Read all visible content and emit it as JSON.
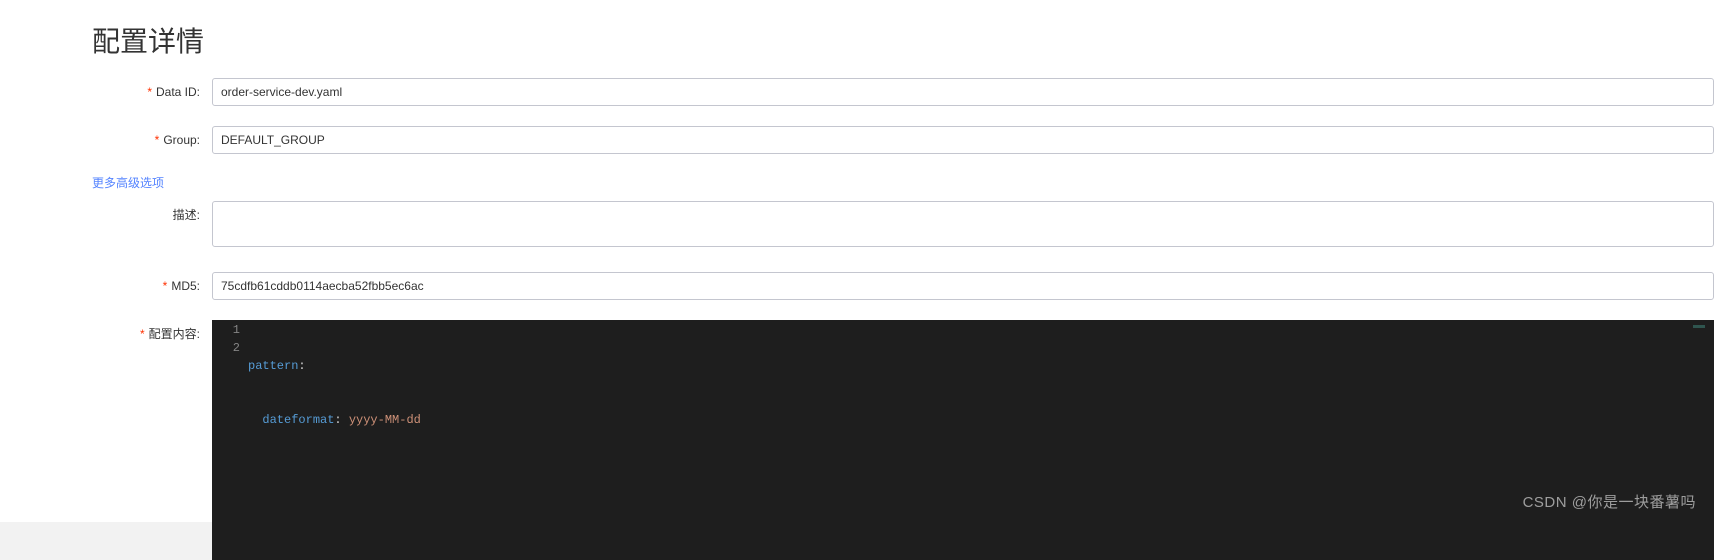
{
  "page": {
    "title": "配置详情"
  },
  "form": {
    "dataId": {
      "label": "Data ID:",
      "value": "order-service-dev.yaml"
    },
    "group": {
      "label": "Group:",
      "value": "DEFAULT_GROUP"
    },
    "advancedLink": "更多高级选项",
    "description": {
      "label": "描述:",
      "value": ""
    },
    "md5": {
      "label": "MD5:",
      "value": "75cdfb61cddb0114aecba52fbb5ec6ac"
    },
    "content": {
      "label": "配置内容:",
      "lines": [
        {
          "num": "1",
          "key": "pattern",
          "value": ""
        },
        {
          "num": "2",
          "indent": "  ",
          "key": "dateformat",
          "value": "yyyy-MM-dd"
        }
      ]
    }
  },
  "watermark": "CSDN @你是一块番薯吗"
}
